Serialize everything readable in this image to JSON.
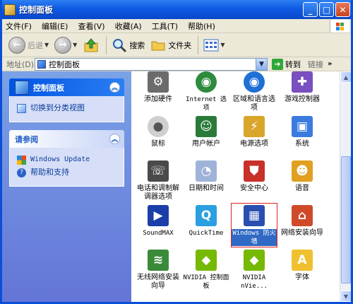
{
  "window": {
    "title": "控制面板"
  },
  "title_buttons": {
    "minimize": "_",
    "maximize": "□",
    "close": "✕"
  },
  "menu": [
    "文件(F)",
    "编辑(E)",
    "查看(V)",
    "收藏(A)",
    "工具(T)",
    "帮助(H)"
  ],
  "toolbar": {
    "back": "后退",
    "search": "搜索",
    "folders": "文件夹"
  },
  "address": {
    "label": "地址(D)",
    "value": "控制面板",
    "go": "转到",
    "links": "链接"
  },
  "sidebar": {
    "panel1": {
      "title": "控制面板",
      "link": "切换到分类视图"
    },
    "panel2": {
      "title": "请参阅",
      "links": [
        "Windows Update",
        "帮助和支持"
      ]
    }
  },
  "items": [
    {
      "label": "添加硬件",
      "icon": "hardware-icon",
      "color": "#6b6b6b"
    },
    {
      "label": "Internet 选项",
      "icon": "globe-icon",
      "color": "#2e8b3e"
    },
    {
      "label": "区域和语言选项",
      "icon": "globe-icon",
      "color": "#1f6fd6"
    },
    {
      "label": "游戏控制器",
      "icon": "gamepad-icon",
      "color": "#7a4fbf"
    },
    {
      "label": "鼠标",
      "icon": "mouse-icon",
      "color": "#cfcfcf"
    },
    {
      "label": "用户帐户",
      "icon": "users-icon",
      "color": "#2a7b3a"
    },
    {
      "label": "电源选项",
      "icon": "power-icon",
      "color": "#d9a52a"
    },
    {
      "label": "系统",
      "icon": "computer-icon",
      "color": "#3b7be0"
    },
    {
      "label": "电话和调制解调器选项",
      "icon": "phone-icon",
      "color": "#4a4a4a"
    },
    {
      "label": "日期和时间",
      "icon": "clock-icon",
      "color": "#9fb3d8"
    },
    {
      "label": "安全中心",
      "icon": "shield-icon",
      "color": "#c8302a"
    },
    {
      "label": "语音",
      "icon": "speech-icon",
      "color": "#e0a020"
    },
    {
      "label": "SoundMAX",
      "icon": "play-icon",
      "color": "#1a3fa8"
    },
    {
      "label": "QuickTime",
      "icon": "quicktime-icon",
      "color": "#2aa0e0"
    },
    {
      "label": "Windows 防火墙",
      "icon": "firewall-icon",
      "color": "#2a4fb0"
    },
    {
      "label": "网络安装向导",
      "icon": "home-network-icon",
      "color": "#d04a2a"
    },
    {
      "label": "无线网络安装向导",
      "icon": "wireless-icon",
      "color": "#3a8a3a"
    },
    {
      "label": "NVIDIA 控制面板",
      "icon": "nvidia-icon",
      "color": "#76b900"
    },
    {
      "label": "NVIDIA nVie...",
      "icon": "nvidia-icon",
      "color": "#76b900"
    },
    {
      "label": "字体",
      "icon": "fonts-folder-icon",
      "color": "#f0c030"
    }
  ]
}
